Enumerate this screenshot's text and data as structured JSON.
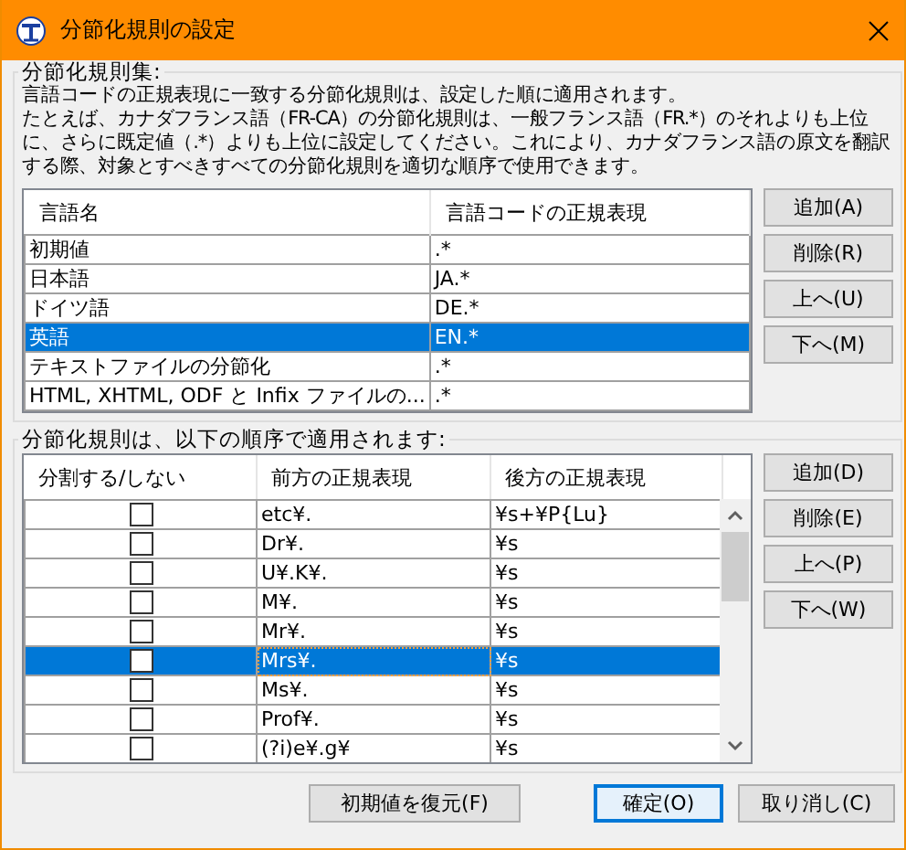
{
  "window": {
    "title": "分節化規則の設定"
  },
  "rule_sets": {
    "label": "分節化規則集:",
    "description": [
      "言語コードの正規表現に一致する分節化規則は、設定した順に適用されます。",
      "たとえば、カナダフランス語（FR-CA）の分節化規則は、一般フランス語（FR.*）のそれよりも上位に、さらに既定値（.*）よりも上位に設定してください。これにより、カナダフランス語の原文を翻訳する際、対象とすべきすべての分節化規則を適切な順序で使用できます。"
    ],
    "columns": [
      "言語名",
      "言語コードの正規表現"
    ],
    "rows": [
      {
        "name": "初期値",
        "pattern": ".*",
        "selected": false
      },
      {
        "name": "日本語",
        "pattern": "JA.*",
        "selected": false
      },
      {
        "name": "ドイツ語",
        "pattern": "DE.*",
        "selected": false
      },
      {
        "name": "英語",
        "pattern": "EN.*",
        "selected": true
      },
      {
        "name": "テキストファイルの分節化",
        "pattern": ".*",
        "selected": false
      },
      {
        "name": "HTML, XHTML, ODF と Infix ファイルの...",
        "pattern": ".*",
        "selected": false
      }
    ],
    "buttons": [
      "追加(A)",
      "削除(R)",
      "上へ(U)",
      "下へ(M)"
    ]
  },
  "rules": {
    "label": "分節化規則は、以下の順序で適用されます:",
    "columns": [
      "分割する/しない",
      "前方の正規表現",
      "後方の正規表現"
    ],
    "rows": [
      {
        "checked": false,
        "before": "etc¥.",
        "after": "¥s+¥P{Lu}",
        "selected": false
      },
      {
        "checked": false,
        "before": "Dr¥.",
        "after": "¥s",
        "selected": false
      },
      {
        "checked": false,
        "before": "U¥.K¥.",
        "after": "¥s",
        "selected": false
      },
      {
        "checked": false,
        "before": "M¥.",
        "after": "¥s",
        "selected": false
      },
      {
        "checked": false,
        "before": "Mr¥.",
        "after": "¥s",
        "selected": false
      },
      {
        "checked": false,
        "before": "Mrs¥.",
        "after": "¥s",
        "selected": true
      },
      {
        "checked": false,
        "before": "Ms¥.",
        "after": "¥s",
        "selected": false
      },
      {
        "checked": false,
        "before": "Prof¥.",
        "after": "¥s",
        "selected": false
      },
      {
        "checked": false,
        "before": "(?i)e¥.g¥",
        "after": "¥s",
        "selected": false
      }
    ],
    "buttons": [
      "追加(D)",
      "削除(E)",
      "上へ(P)",
      "下へ(W)"
    ]
  },
  "footer_buttons": [
    {
      "label": "初期値を復元(F)",
      "default": false
    },
    {
      "label": "確定(O)",
      "default": true
    },
    {
      "label": "取り消し(C)",
      "default": false
    }
  ]
}
